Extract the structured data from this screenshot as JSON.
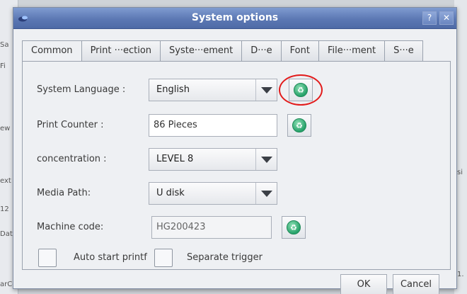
{
  "background": {
    "left_labels": [
      "Sa",
      "Fi",
      "ew",
      "ext",
      "12",
      "Date",
      "arCo"
    ],
    "right_labels": [
      "si",
      "1."
    ]
  },
  "dialog": {
    "title": "System options",
    "help_label": "?",
    "close_label": "✕"
  },
  "tabs": [
    {
      "label": "Common",
      "active": true
    },
    {
      "label": "Print ···ection",
      "active": false
    },
    {
      "label": "Syste···ement",
      "active": false
    },
    {
      "label": "D···e",
      "active": false
    },
    {
      "label": "Font",
      "active": false
    },
    {
      "label": "File···ment",
      "active": false
    },
    {
      "label": "S···e",
      "active": false
    }
  ],
  "common": {
    "system_language": {
      "label": "System Language :",
      "value": "English"
    },
    "print_counter": {
      "label": "Print Counter :",
      "value": "86  Pieces"
    },
    "concentration": {
      "label": "concentration :",
      "value": "LEVEL 8"
    },
    "media_path": {
      "label": "Media Path:",
      "value": "U disk"
    },
    "machine_code": {
      "label": "Machine code:",
      "value": "HG200423"
    },
    "auto_start": {
      "label": "Auto start printf",
      "checked": false
    },
    "separate_trigger": {
      "label": "Separate trigger",
      "checked": false
    }
  },
  "footer": {
    "ok_label": "OK",
    "cancel_label": "Cancel"
  },
  "colors": {
    "titlebar": "#5c78b4",
    "highlight_ring": "#e21b1b",
    "reset_icon": "#26a26a"
  },
  "icons": {
    "reset": "recycle-reset-icon",
    "app": "app-logo-icon"
  }
}
